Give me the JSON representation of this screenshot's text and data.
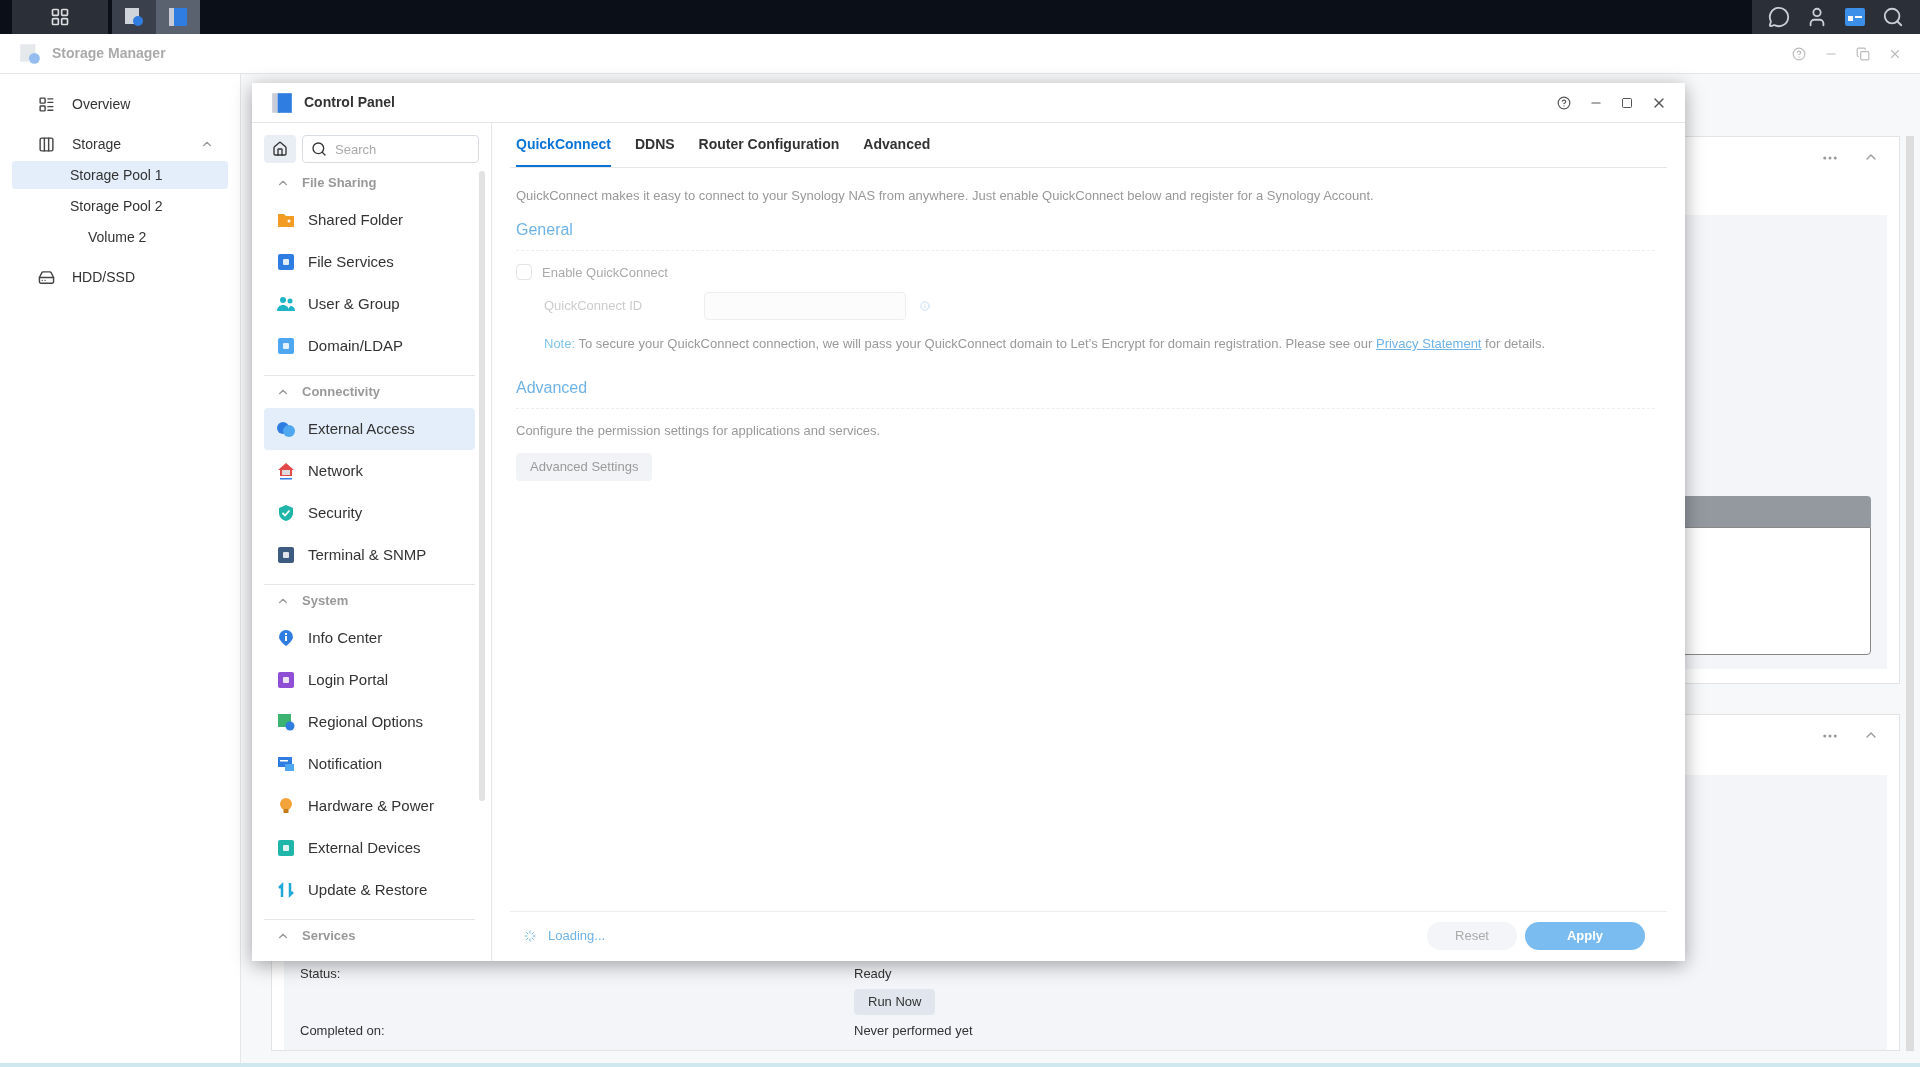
{
  "taskbar": {
    "apps": [
      {
        "selected": false
      },
      {
        "selected": true
      }
    ]
  },
  "storage_manager": {
    "title": "Storage Manager",
    "sidebar": [
      {
        "label": "Overview",
        "selected": false
      },
      {
        "label": "Storage",
        "selected": false,
        "expanded": true,
        "children": [
          {
            "label": "Storage Pool 1",
            "selected": true
          },
          {
            "label": "Storage Pool 2",
            "selected": false,
            "children": [
              {
                "label": "Volume 2",
                "selected": false
              }
            ]
          }
        ]
      },
      {
        "label": "HDD/SSD",
        "selected": false
      }
    ],
    "task": {
      "status_label": "Status:",
      "status_value": "Ready",
      "run_button": "Run Now",
      "completed_label": "Completed on:",
      "completed_value": "Never performed yet"
    }
  },
  "control_panel": {
    "title": "Control Panel",
    "search": {
      "placeholder": "Search"
    },
    "sections": [
      {
        "title": "File Sharing",
        "expanded": true,
        "items": [
          {
            "label": "Shared Folder",
            "selected": false
          },
          {
            "label": "File Services",
            "selected": false
          },
          {
            "label": "User & Group",
            "selected": false
          },
          {
            "label": "Domain/LDAP",
            "selected": false
          }
        ]
      },
      {
        "title": "Connectivity",
        "expanded": true,
        "items": [
          {
            "label": "External Access",
            "selected": true
          },
          {
            "label": "Network",
            "selected": false
          },
          {
            "label": "Security",
            "selected": false
          },
          {
            "label": "Terminal & SNMP",
            "selected": false
          }
        ]
      },
      {
        "title": "System",
        "expanded": true,
        "items": [
          {
            "label": "Info Center",
            "selected": false
          },
          {
            "label": "Login Portal",
            "selected": false
          },
          {
            "label": "Regional Options",
            "selected": false
          },
          {
            "label": "Notification",
            "selected": false
          },
          {
            "label": "Hardware & Power",
            "selected": false
          },
          {
            "label": "External Devices",
            "selected": false
          },
          {
            "label": "Update & Restore",
            "selected": false
          }
        ]
      },
      {
        "title": "Services",
        "expanded": true
      }
    ],
    "tabs": [
      {
        "label": "QuickConnect",
        "selected": true
      },
      {
        "label": "DDNS",
        "selected": false
      },
      {
        "label": "Router Configuration",
        "selected": false
      },
      {
        "label": "Advanced",
        "selected": false
      }
    ],
    "description": "QuickConnect makes it easy to connect to your Synology NAS from anywhere. Just enable QuickConnect below and register for a Synology Account.",
    "general": {
      "heading": "General",
      "enable": {
        "label": "Enable QuickConnect",
        "checked": false,
        "disabled": true
      },
      "id_field": {
        "label": "QuickConnect ID",
        "disabled": true
      },
      "note": {
        "prefix": "Note:",
        "text": "To secure your QuickConnect connection, we will pass your QuickConnect domain to Let’s Encrypt for domain registration. Please see our",
        "link": "Privacy Statement",
        "suffix": "for details."
      }
    },
    "advanced": {
      "heading": "Advanced",
      "description": "Configure the permission settings for applications and services.",
      "button": {
        "label": "Advanced Settings",
        "disabled": true
      }
    },
    "footer": {
      "status": "Loading...",
      "reset": {
        "label": "Reset",
        "disabled": true
      },
      "apply": {
        "label": "Apply",
        "disabled": false
      }
    }
  }
}
